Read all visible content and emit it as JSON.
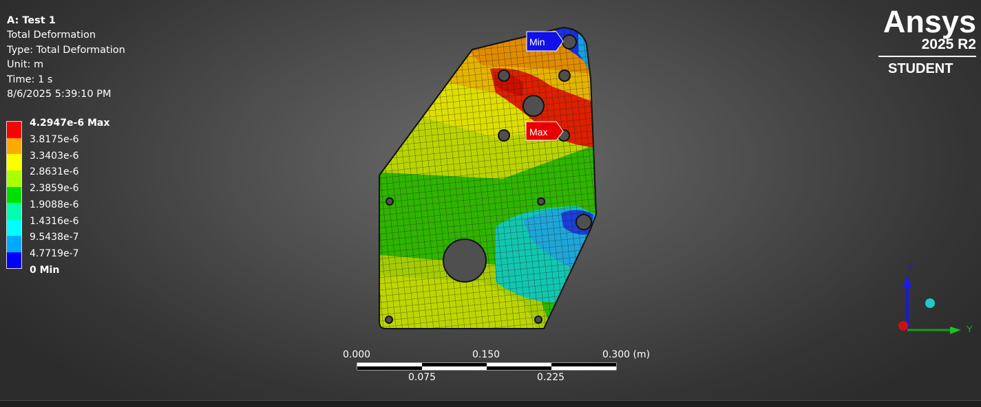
{
  "info": {
    "title": "A: Test 1",
    "result": "Total Deformation",
    "type": "Type: Total Deformation",
    "unit": "Unit: m",
    "time": "Time: 1 s",
    "timestamp": "8/6/2025 5:39:10 PM"
  },
  "legend": {
    "labels": [
      "4.2947e-6 Max",
      "3.8175e-6",
      "3.3403e-6",
      "2.8631e-6",
      "2.3859e-6",
      "1.9088e-6",
      "1.4316e-6",
      "9.5438e-7",
      "4.7719e-7",
      "0 Min"
    ],
    "colors": [
      "#ff0000",
      "#ffaa00",
      "#ffff00",
      "#aaff00",
      "#00e000",
      "#00ffaa",
      "#00ffff",
      "#00aaff",
      "#0000ff"
    ]
  },
  "logo": {
    "name": "Ansys",
    "version": "2025 R2",
    "edition": "STUDENT"
  },
  "probes": {
    "min": "Min",
    "max": "Max"
  },
  "scale": {
    "top_labels": [
      "0.000",
      "0.150",
      "0.300 (m)"
    ],
    "bottom_labels": [
      "0.075",
      "0.225"
    ]
  },
  "triad": {
    "z": "Z",
    "y": "Y"
  }
}
